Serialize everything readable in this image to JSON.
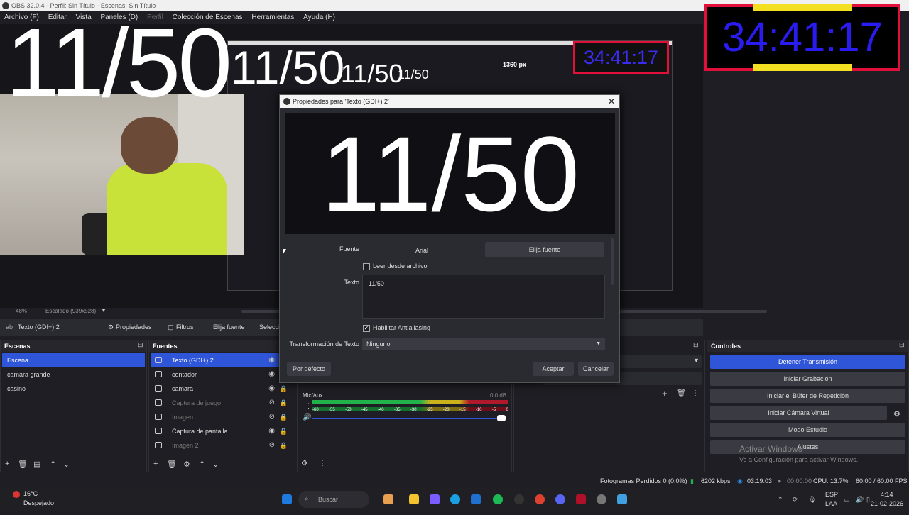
{
  "window": {
    "title": "OBS 32.0.4 - Perfil: Sin Título - Escenas: Sin Título"
  },
  "menu": {
    "items": [
      "Archivo (F)",
      "Editar",
      "Vista",
      "Paneles (D)",
      "Perfil",
      "Colección de Escenas",
      "Herramientas",
      "Ayuda (H)"
    ]
  },
  "overlay": {
    "counter": "11/50",
    "timer": "34:41:17",
    "px_label": "1360 px"
  },
  "preview_bar": {
    "zoom": "48%",
    "scaled": "Escalado (939x528)"
  },
  "source_toolbar": {
    "source_name": "Texto (GDI+) 2",
    "properties": "Propiedades",
    "filters": "Filtros",
    "choose_font": "Elija fuente",
    "select": "Selecci"
  },
  "dialog": {
    "title": "Propiedades para 'Texto (GDI+) 2'",
    "preview_text": "11/50",
    "font_label": "Fuente",
    "font_value": "Arial",
    "font_button": "Elija fuente",
    "read_from_file": "Leer desde archivo",
    "text_label": "Texto",
    "text_value": "11/50",
    "antialiasing": "Habilitar Antialiasing",
    "transform_label": "Transformación de Texto",
    "transform_value": "Ninguno",
    "defaults_button": "Por defecto",
    "accept_button": "Aceptar",
    "cancel_button": "Cancelar"
  },
  "scenes": {
    "title": "Escenas",
    "items": [
      "Escena",
      "camara grande",
      "casino"
    ]
  },
  "sources": {
    "title": "Fuentes",
    "items": [
      "Texto (GDI+) 2",
      "contador",
      "camara",
      "Captura de juego",
      "Imagen",
      "Captura de pantalla",
      "Imagen 2"
    ]
  },
  "audio": {
    "label": "Mic/Aux",
    "db": "0.0 dB",
    "ticks": [
      "-60",
      "-55",
      "-50",
      "-45",
      "-40",
      "-35",
      "-30",
      "-25",
      "-20",
      "-15",
      "-10",
      "-5",
      "0"
    ]
  },
  "controls": {
    "title": "Controles",
    "stop_stream": "Detener Transmisión",
    "start_recording": "Iniciar Grabación",
    "replay_buffer": "Iniciar el Búfer de Repetición",
    "virtual_camera": "Iniciar Cámara Virtual",
    "studio_mode": "Modo Estudio",
    "settings": "Ajustes"
  },
  "watermark": {
    "line1": "Activar Windows",
    "line2": "Ve a Configuración para activar Windows."
  },
  "status": {
    "dropped_frames": "Fotogramas Perdidos 0 (0.0%)",
    "bitrate": "6202 kbps",
    "stream_time": "03:19:03",
    "rec_time": "00:00:00",
    "cpu": "CPU: 13.7%",
    "fps": "60.00 / 60.00 FPS"
  },
  "taskbar": {
    "temperature": "16°C",
    "weather": "Despejado",
    "search_placeholder": "Buscar",
    "lang1": "ESP",
    "lang2": "LAA",
    "time": "4:14",
    "date": "21-02-2026"
  },
  "colors": {
    "accent": "#2f55d8",
    "timer_frame": "#e0103a",
    "timer_text": "#2a1cf0",
    "timer_tab": "#f3e023"
  }
}
